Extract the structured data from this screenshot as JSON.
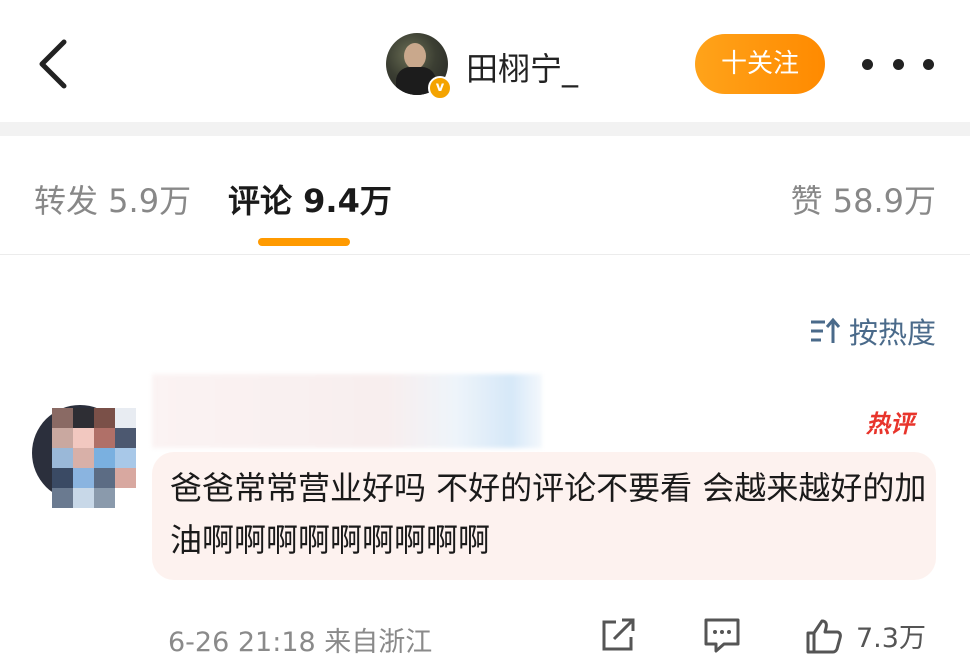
{
  "header": {
    "username": "田栩宁_",
    "follow_label": "十关注",
    "verified_badge": "v"
  },
  "tabs": {
    "repost": "转发 5.9万",
    "comment": "评论 9.4万",
    "like": "赞 58.9万"
  },
  "sort": {
    "label": "按热度"
  },
  "comment": {
    "hot_badge": "热评",
    "text": "爸爸常常营业好吗 不好的评论不要看 会越来越好的加油啊啊啊啊啊啊啊啊啊",
    "meta": "6-26 21:18 来自浙江",
    "like_count": "7.3万"
  },
  "colors": {
    "accent": "#ff9a00",
    "hot_badge": "#e8342b",
    "sort_text": "#4a6a8a",
    "bubble_bg": "#fdf2ef"
  },
  "icons": [
    "back-arrow-icon",
    "more-dots-icon",
    "sort-icon",
    "share-icon",
    "comment-icon",
    "like-icon"
  ]
}
